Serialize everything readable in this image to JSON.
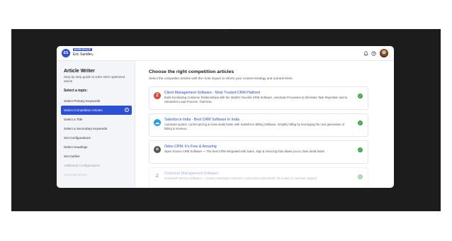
{
  "header_text": "…",
  "workspace": {
    "initials": "ES",
    "badge": "WORKSPACE",
    "user": "Eric Sandler",
    "chevron": "⌄"
  },
  "topbar_icons": [
    "bell-icon",
    "help-icon",
    "profile-avatar"
  ],
  "sidebar": {
    "title": "Article Writer",
    "description": "Step by step guide to write SEO optimized article",
    "select_label": "Select a topic:",
    "items": [
      {
        "label": "Select Primary Keywords",
        "state": "normal"
      },
      {
        "label": "Select Competition Articles",
        "state": "active"
      },
      {
        "label": "Select a Title",
        "state": "normal"
      },
      {
        "label": "Select a Secondary Keywords",
        "state": "normal"
      },
      {
        "label": "Set Configurations",
        "state": "normal"
      },
      {
        "label": "Select Headings",
        "state": "normal"
      },
      {
        "label": "Set Outline",
        "state": "normal"
      },
      {
        "label": "Additional Configurations",
        "state": "faded"
      },
      {
        "label": "Generate article",
        "state": "faded2"
      }
    ]
  },
  "main": {
    "title": "Choose the right competition articles",
    "subtitle": "Select the competitor articles with the most impact to inform your content strategy and outrank them.",
    "articles": [
      {
        "logo": "Z",
        "logo_bg": "#d9483b",
        "title": "Client Management Software - Most Trusted CRM Platform",
        "description": "Build Everlasting Customer Relationships with the World's Favorite CRM Software. Automate Processes to Eliminate Task Repetition and to Streamline Lead Process. Trial Now.",
        "selected": true
      },
      {
        "logo": "☁",
        "logo_bg": "#1ea1e8",
        "title": "Salesforce India - Best CRM Software In India",
        "description": "Automate quotes, control pricing & close deals faster with Salesforce Billing Software. Simplify billing by leveraging the next generation of billing & revenue...",
        "selected": true
      },
      {
        "logo": "o",
        "logo_bg": "#555555",
        "title": "Odoo CRM: It's Free & Amazing",
        "description": "Open Source CRM Software — The best CRM Integrated with Sales, Sign & Invoicing that allows you to close deals faster",
        "selected": true
      },
      {
        "logo": "Z",
        "logo_bg": "#ffffff",
        "title": "Customer Management Software",
        "description": "Zendesk® Service Software — Create meaningful customer connections w/Zendesk, the leader in customer support",
        "selected": true
      }
    ]
  },
  "colors": {
    "accent": "#2d4fd6",
    "success": "#3ca84a",
    "frame": "#1c1c1c"
  }
}
